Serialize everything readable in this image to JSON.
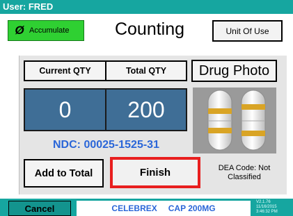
{
  "topbar": {
    "user": "User: FRED"
  },
  "header": {
    "accumulate_label": "Accumulate",
    "title": "Counting",
    "unit_button": "Unit Of Use"
  },
  "quantities": {
    "current_label": "Current QTY",
    "total_label": "Total QTY",
    "current_value": "0",
    "total_value": "200"
  },
  "drug_photo_label": "Drug Photo",
  "ndc": "NDC: 00025-1525-31",
  "buttons": {
    "add_to_total": "Add to Total",
    "finish": "Finish",
    "cancel": "Cancel"
  },
  "dea": "DEA Code: Not Classified",
  "footer": {
    "drug_name": "CELEBREX",
    "drug_strength": "CAP 200MG",
    "version": "V2.1.76",
    "date": "11/16/2015",
    "time": "3:46:32 PM"
  },
  "icons": {
    "accumulate": "check-slash-icon"
  },
  "colors": {
    "teal_bar": "#16a6a0",
    "accumulate_green": "#2fd032",
    "qty_blue": "#3f6e96",
    "ndc_blue": "#2a66d8",
    "finish_highlight": "#e81e1e"
  }
}
